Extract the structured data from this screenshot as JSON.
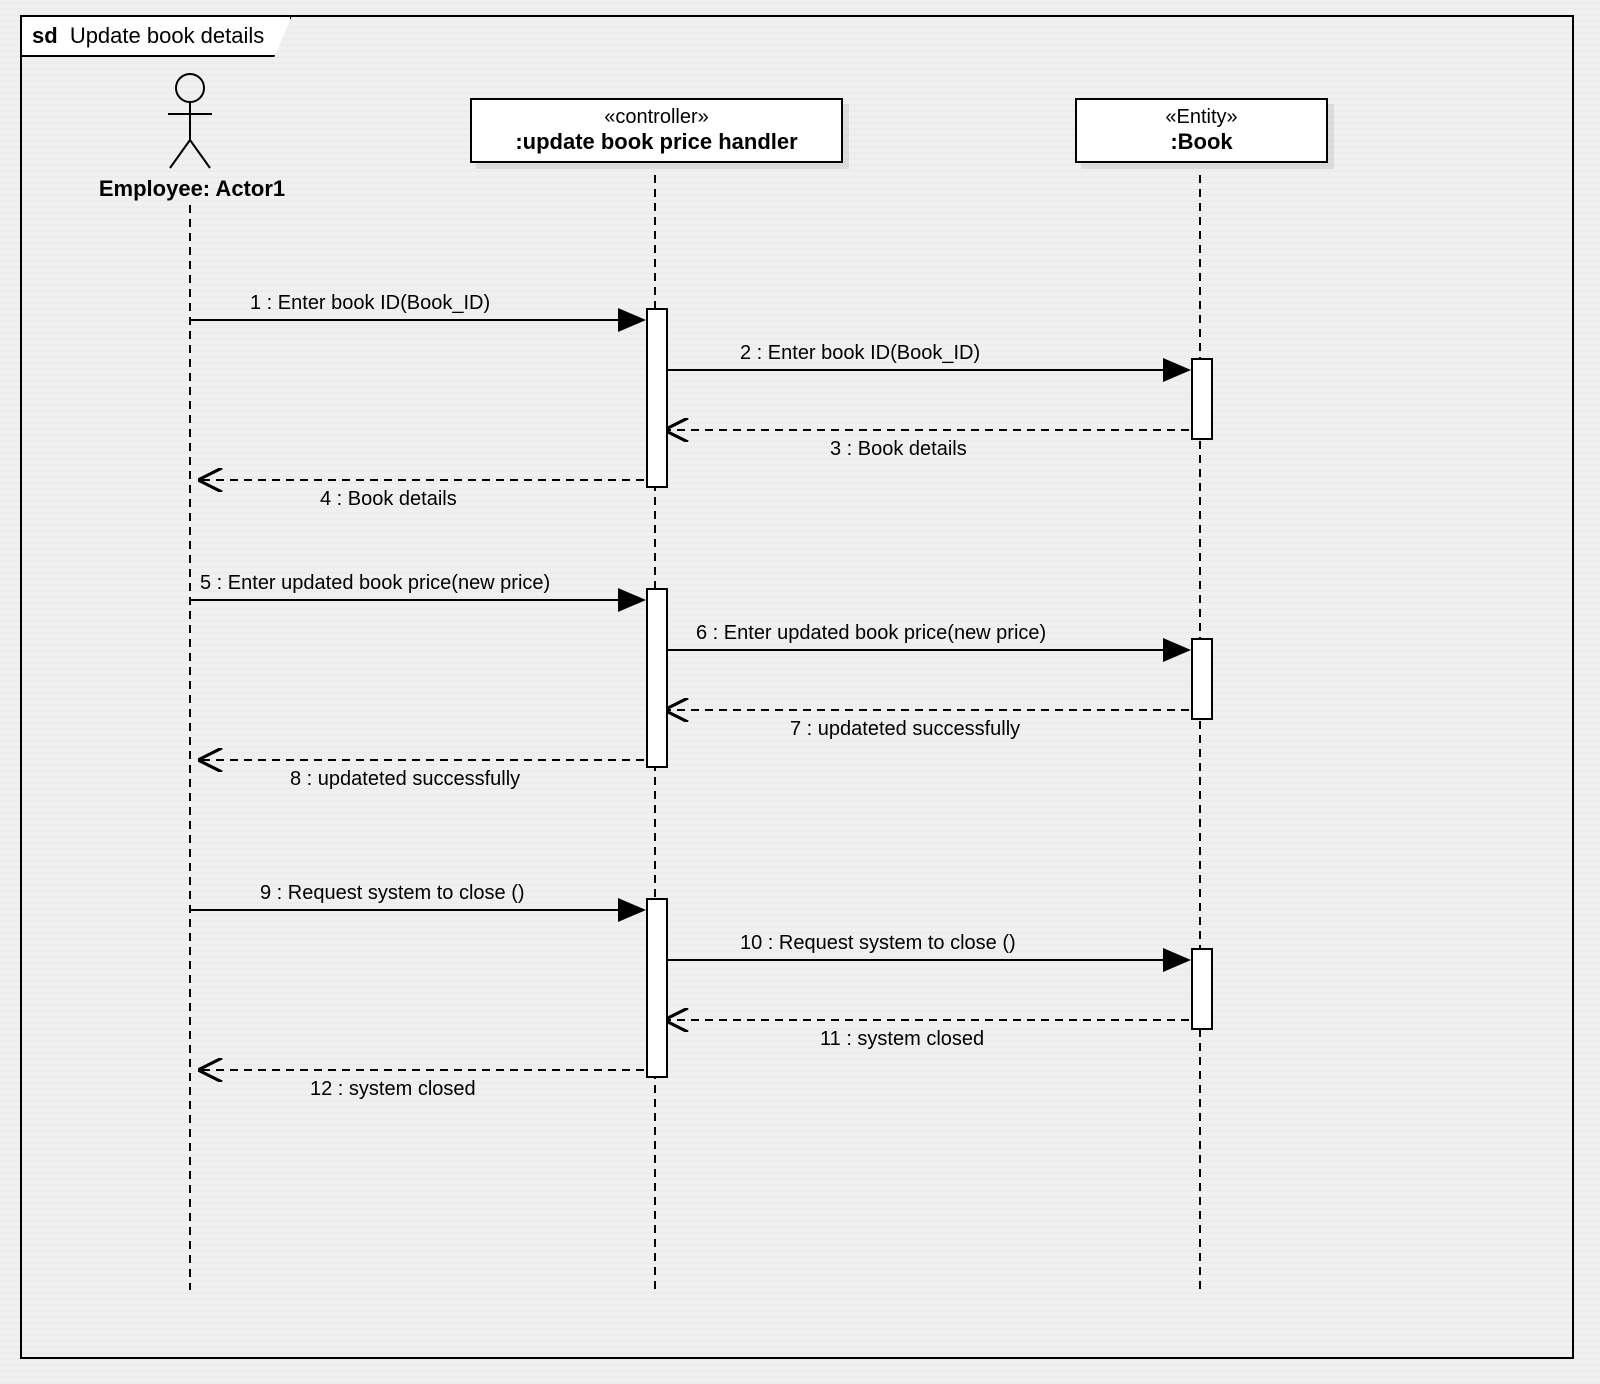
{
  "frame": {
    "sd": "sd",
    "title": "Update book details"
  },
  "lifelines": {
    "actor": {
      "label": "Employee: Actor1"
    },
    "controller": {
      "stereotype": "«controller»",
      "name": ":update book price handler"
    },
    "entity": {
      "stereotype": "«Entity»",
      "name": ":Book"
    }
  },
  "messages": {
    "m1": "1 : Enter book ID(Book_ID)",
    "m2": "2 : Enter book ID(Book_ID)",
    "m3": "3 : Book details",
    "m4": "4 : Book details",
    "m5": "5 : Enter updated book price(new price)",
    "m6": "6 : Enter updated book price(new price)",
    "m7": "7 : updateted successfully",
    "m8": "8 : updateted successfully",
    "m9": "9 : Request system to close ()",
    "m10": "10 : Request system to close ()",
    "m11": "11 : system closed",
    "m12": "12 : system closed"
  }
}
